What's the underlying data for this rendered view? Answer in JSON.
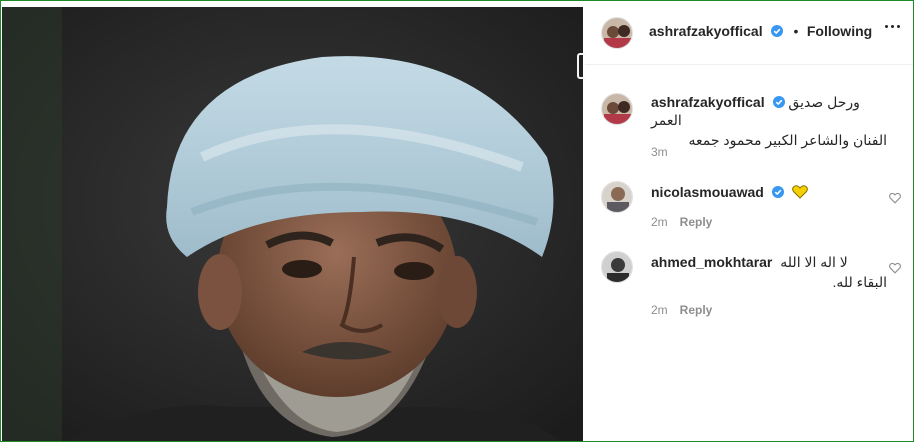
{
  "post": {
    "author": "ashrafzakyoffical",
    "follow_state": "Following",
    "caption_line1": "ورحل صديق العمر",
    "caption_line2": "الفنان والشاعر الكبير محمود جمعه",
    "time": "3m"
  },
  "comments": [
    {
      "user": "nicolasmouawad",
      "text": "",
      "time": "2m",
      "reply": "Reply",
      "verified": true
    },
    {
      "user": "ahmed_mokhtarar",
      "text_line1": "لا اله الا الله",
      "text_line2": "البقاء لله.",
      "time": "2m",
      "reply": "Reply",
      "verified": false
    }
  ],
  "colors": {
    "verified": "#3897f0",
    "heart_emoji": "#f7d000",
    "frame": "#1f8a2a"
  },
  "icons": {
    "more": "more-options-icon",
    "like": "heart-outline-icon",
    "verified": "verified-badge-icon"
  }
}
